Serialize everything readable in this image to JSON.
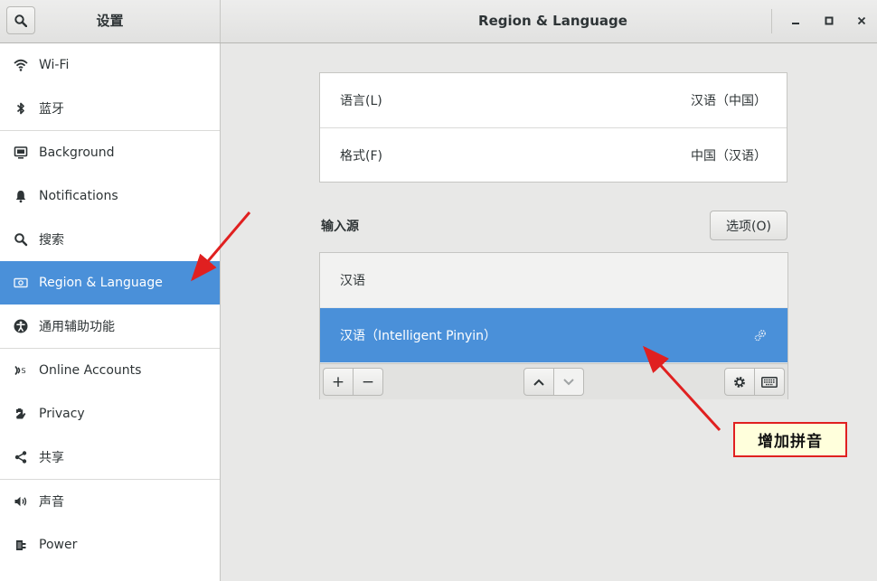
{
  "header": {
    "sidebar_title": "设置",
    "window_title": "Region & Language",
    "controls": {
      "minimize": "–",
      "maximize": "□",
      "close": "×"
    }
  },
  "sidebar": {
    "items": [
      {
        "label": "Wi-Fi",
        "icon": "wifi-icon"
      },
      {
        "label": "蓝牙",
        "icon": "bluetooth-icon"
      },
      {
        "label": "Background",
        "icon": "background-icon"
      },
      {
        "label": "Notifications",
        "icon": "bell-icon"
      },
      {
        "label": "搜索",
        "icon": "search-icon"
      },
      {
        "label": "Region & Language",
        "icon": "region-flag-icon",
        "selected": true
      },
      {
        "label": "通用辅助功能",
        "icon": "accessibility-icon"
      },
      {
        "label": "Online Accounts",
        "icon": "online-accounts-icon"
      },
      {
        "label": "Privacy",
        "icon": "hand-icon"
      },
      {
        "label": "共享",
        "icon": "share-icon"
      },
      {
        "label": "声音",
        "icon": "speaker-icon"
      },
      {
        "label": "Power",
        "icon": "power-plug-icon"
      }
    ]
  },
  "region": {
    "language_label": "语言(L)",
    "language_value": "汉语（中国）",
    "formats_label": "格式(F)",
    "formats_value": "中国（汉语）"
  },
  "input_sources": {
    "section_label": "输入源",
    "options_button": "选项(O)",
    "items": [
      {
        "label": "汉语",
        "selected": false
      },
      {
        "label": "汉语（Intelligent Pinyin）",
        "selected": true
      }
    ],
    "toolbar": {
      "add": "+",
      "remove": "−"
    }
  },
  "annotation": {
    "callout_text": "增加拼音",
    "arrow_color": "#e02020"
  },
  "colors": {
    "accent": "#4a90d9",
    "background": "#e8e8e7",
    "callout_bg": "#ffffdc"
  }
}
